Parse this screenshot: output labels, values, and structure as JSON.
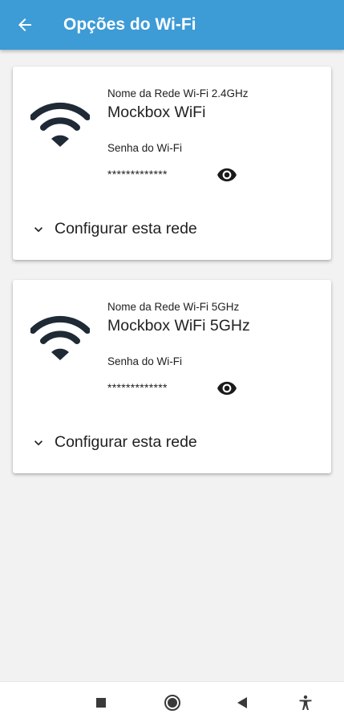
{
  "appbar": {
    "title": "Opções do Wi-Fi",
    "back_icon": "arrow-left-icon",
    "background": "#3d9bd6"
  },
  "networks": [
    {
      "name_label": "Nome da Rede Wi-Fi 2.4GHz",
      "name": "Mockbox WiFi",
      "password_label": "Senha do Wi-Fi",
      "password": "*************",
      "configure_label": "Configurar esta rede"
    },
    {
      "name_label": "Nome da Rede Wi-Fi 5GHz",
      "name": "Mockbox WiFi 5GHz",
      "password_label": "Senha do Wi-Fi",
      "password": "*************",
      "configure_label": "Configurar esta rede"
    }
  ],
  "navbar": {
    "icons": [
      "recents-square-icon",
      "home-circle-icon",
      "back-triangle-icon",
      "accessibility-icon"
    ]
  }
}
